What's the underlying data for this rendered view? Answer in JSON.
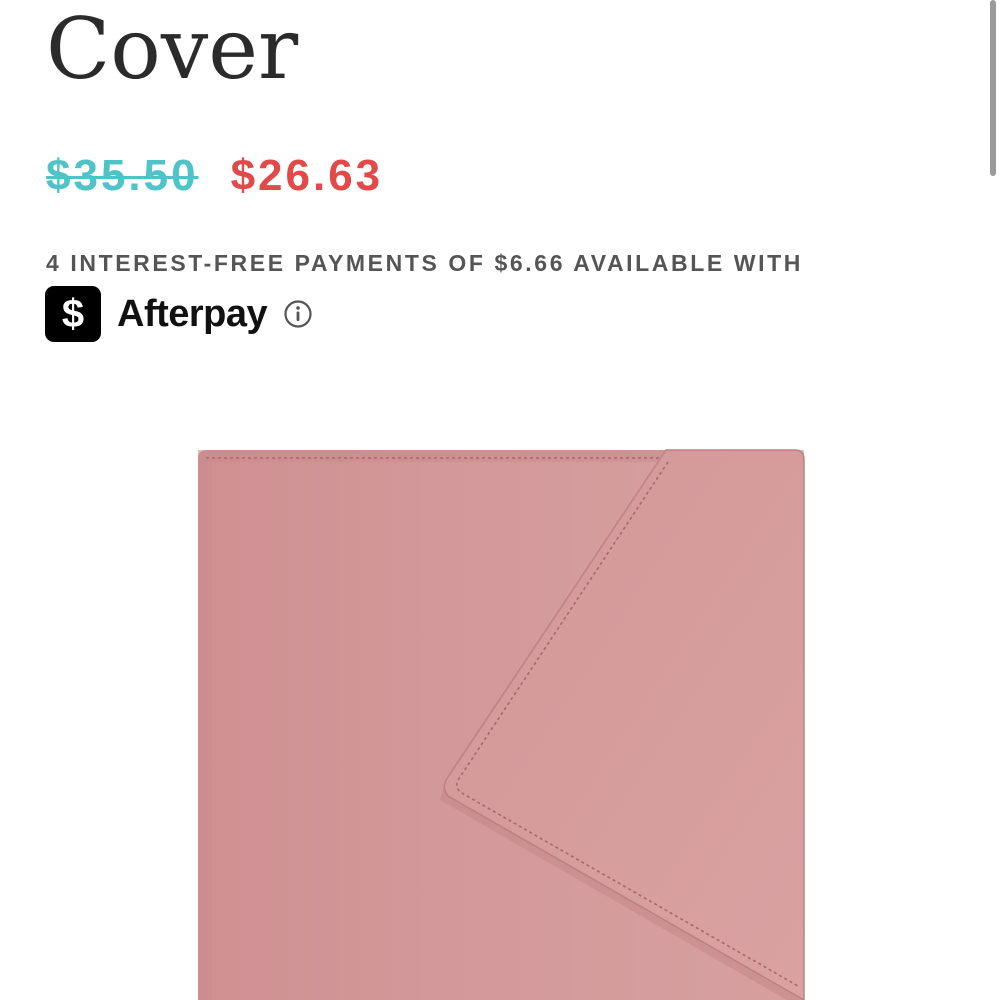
{
  "product": {
    "title": "Cover",
    "original_price": "$35.50",
    "sale_price": "$26.63"
  },
  "payments": {
    "installment_text": "4 INTEREST-FREE PAYMENTS OF $6.66 AVAILABLE WITH",
    "provider_name": "Afterpay",
    "provider_logo_glyph": "$",
    "info_icon": "info-icon"
  },
  "colors": {
    "original_price": "#4fc3c8",
    "sale_price": "#e24a4a",
    "product_pink": "#d6999a"
  },
  "icons": {
    "logo": "afterpay-logo-icon",
    "info": "info-icon"
  }
}
